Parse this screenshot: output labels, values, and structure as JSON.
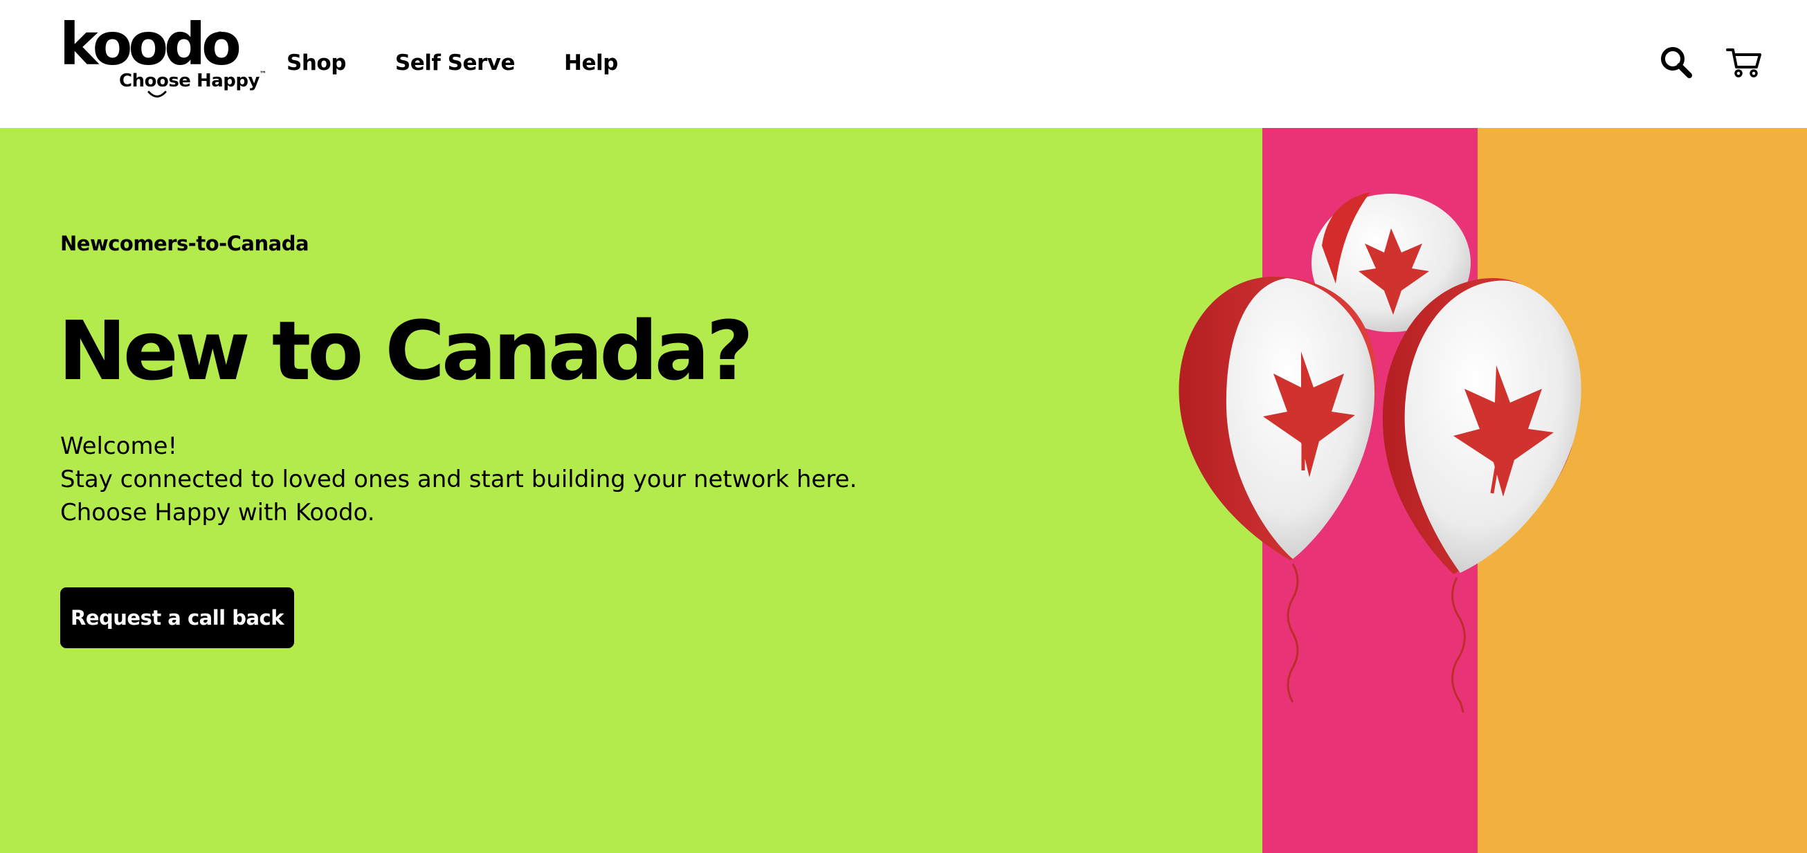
{
  "header": {
    "logo": {
      "wordmark": "koodo",
      "registered": "®",
      "tagline": "Choose Happy",
      "trademark": "™"
    },
    "nav": [
      {
        "label": "Shop"
      },
      {
        "label": "Self Serve"
      },
      {
        "label": "Help"
      }
    ],
    "icons": {
      "search": "search-icon",
      "cart": "cart-icon"
    }
  },
  "hero": {
    "eyebrow": "Newcomers-to-Canada",
    "title": "New to Canada?",
    "copy": [
      "Welcome!",
      "Stay connected to loved ones and start building your network here.",
      "Choose Happy with Koodo."
    ],
    "cta_label": "Request a call back",
    "image": "canada-flag-balloons"
  },
  "colors": {
    "header_bg": "#ffffff",
    "green": "#b3eb4d",
    "pink": "#e83377",
    "orange": "#f2b03f",
    "button_bg": "#000000",
    "button_text": "#ffffff",
    "balloon_red": "#d42b2b",
    "balloon_white": "#f1f1f1"
  }
}
